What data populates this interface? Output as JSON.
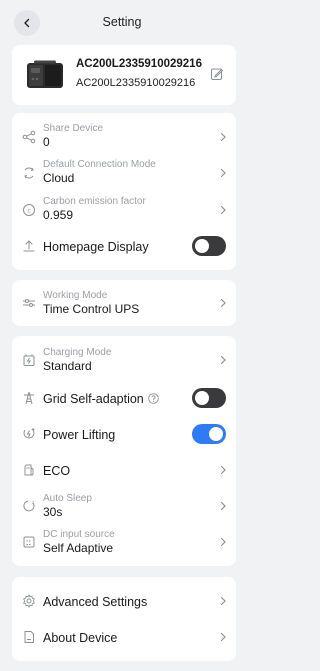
{
  "header": {
    "title": "Setting"
  },
  "device": {
    "name": "AC200L2335910029216",
    "serial": "AC200L2335910029216"
  },
  "section1": {
    "share_device": {
      "label": "Share Device",
      "value": "0"
    },
    "default_connection": {
      "label": "Default Connection Mode",
      "value": "Cloud"
    },
    "carbon_factor": {
      "label": "Carbon emission factor",
      "value": "0.959"
    },
    "homepage_display": {
      "label": "Homepage Display",
      "enabled": false
    }
  },
  "section2": {
    "working_mode": {
      "label": "Working Mode",
      "value": "Time Control UPS"
    }
  },
  "section3": {
    "charging_mode": {
      "label": "Charging Mode",
      "value": "Standard"
    },
    "grid_self_adaption": {
      "label": "Grid Self-adaption",
      "enabled": false
    },
    "power_lifting": {
      "label": "Power Lifting",
      "enabled": true
    },
    "eco": {
      "label": "ECO"
    },
    "auto_sleep": {
      "label": "Auto Sleep",
      "value": "30s"
    },
    "dc_input_source": {
      "label": "DC input source",
      "value": "Self Adaptive"
    }
  },
  "section4": {
    "advanced_settings": {
      "label": "Advanced Settings"
    },
    "about_device": {
      "label": "About Device"
    }
  },
  "colors": {
    "accent": "#2f7bf5",
    "toggle_off": "#3a3a3c",
    "background": "#f1f2f4",
    "card": "#ffffff"
  }
}
